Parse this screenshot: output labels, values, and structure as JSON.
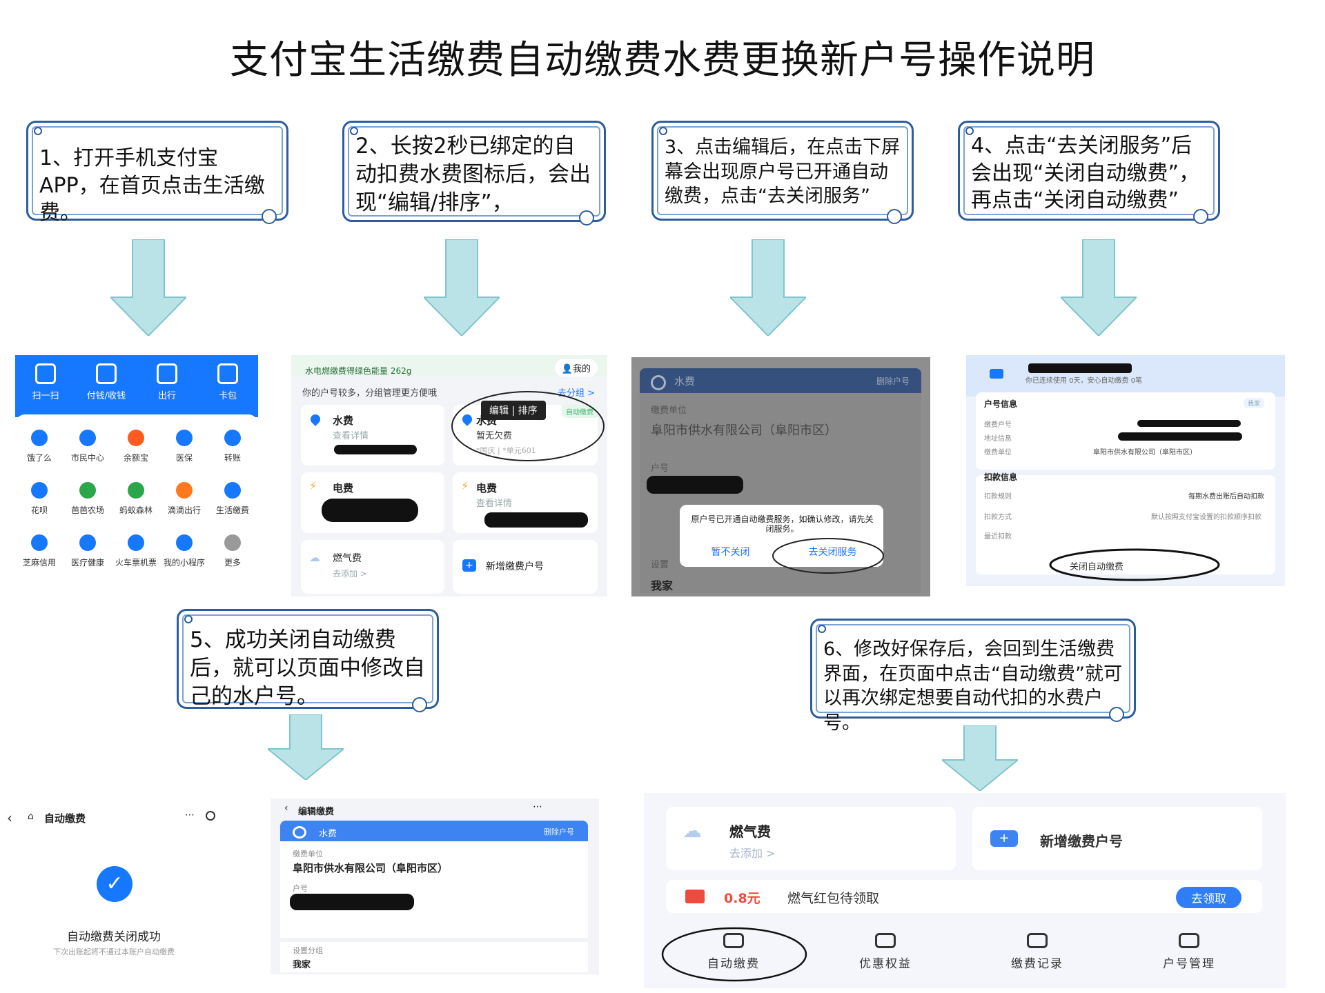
{
  "title": "支付宝生活缴费自动缴费水费更换新户号操作说明",
  "colors": {
    "arrow_fill": "#b9e3e6",
    "arrow_stroke": "#7fc5cb",
    "callout_border": "#2c5d9e",
    "alipay_blue": "#1677ff"
  },
  "steps": [
    "1、打开手机支付宝APP，在首页点击生活缴费。",
    "2、长按2秒已绑定的自动扣费水费图标后，会出现“编辑/排序”，",
    "3、点击编辑后，在点击下屏幕会出现原户号已开通自动缴费，点击“去关闭服务”",
    "4、点击“去关闭服务”后会出现“关闭自动缴费”，再点击“关闭自动缴费”",
    "5、成功关闭自动缴费后，就可以页面中修改自己的水户号。",
    "6、修改好保存后，会回到生活缴费界面，在页面中点击“自动缴费”就可以再次绑定想要自动代扣的水费户号。"
  ],
  "s1": {
    "top": [
      {
        "label": "扫一扫",
        "icon": "scan-icon"
      },
      {
        "label": "付钱/收钱",
        "icon": "pay-icon"
      },
      {
        "label": "出行",
        "icon": "travel-icon"
      },
      {
        "label": "卡包",
        "icon": "card-icon"
      }
    ],
    "grid": [
      {
        "label": "饿了么",
        "icon": "eleme-icon",
        "color": "#1677ff"
      },
      {
        "label": "市民中心",
        "icon": "citizen-icon",
        "color": "#1677ff"
      },
      {
        "label": "余额宝",
        "icon": "yuebao-icon",
        "color": "#ff5a1f"
      },
      {
        "label": "医保",
        "icon": "medical-insurance-icon",
        "color": "#1677ff"
      },
      {
        "label": "转账",
        "icon": "transfer-icon",
        "color": "#1677ff"
      },
      {
        "label": "花呗",
        "icon": "huabei-icon",
        "color": "#1677ff"
      },
      {
        "label": "芭芭农场",
        "icon": "farm-icon",
        "color": "#2ca64a"
      },
      {
        "label": "蚂蚁森林",
        "icon": "forest-icon",
        "color": "#2ca64a"
      },
      {
        "label": "滴滴出行",
        "icon": "didi-icon",
        "color": "#ff7a1f"
      },
      {
        "label": "生活缴费",
        "icon": "utility-bill-icon",
        "color": "#1677ff"
      },
      {
        "label": "芝麻信用",
        "icon": "zhima-icon",
        "color": "#1677ff"
      },
      {
        "label": "医疗健康",
        "icon": "health-icon",
        "color": "#1677ff"
      },
      {
        "label": "火车票机票",
        "icon": "ticket-icon",
        "color": "#1677ff"
      },
      {
        "label": "我的小程序",
        "icon": "miniapp-icon",
        "color": "#1677ff"
      },
      {
        "label": "更多",
        "icon": "more-icon",
        "color": "#999999"
      }
    ]
  },
  "s2": {
    "banner": "水电燃缴费得绿色能量 262g",
    "mine": "我的",
    "hint": "你的户号较多，分组管理更方便哦",
    "group_link": "去分组 >",
    "popup": "编辑 | 排序",
    "water": "水费",
    "water_detail": "查看详情",
    "water2_sub": "暂无欠费",
    "water2_tag": "*国庆 | *单元601",
    "auto_tag": "自动缴费",
    "elec": "电费",
    "elec_detail": "查看详情",
    "gas": "燃气费",
    "gas_add": "去添加 >",
    "add_account": "新增缴费户号"
  },
  "s3": {
    "header": "水费",
    "delete": "删除户号",
    "unit_label": "缴费单位",
    "unit": "阜阳市供水有限公司（阜阳市区）",
    "account_label": "户号",
    "group_label": "设置",
    "group": "我家",
    "dialog_text": "原户号已开通自动缴费服务，如确认修改，请先关闭服务。",
    "cancel": "暂不关闭",
    "confirm": "去关闭服务"
  },
  "s4": {
    "days": "你已连续使用 0天，安心自动缴费 0笔",
    "account_info": "户号信息",
    "tag": "我家",
    "rows": [
      "缴费户号",
      "地址信息",
      "缴费单位"
    ],
    "unit": "阜阳市供水有限公司（阜阳市区）",
    "deduct_info": "扣款信息",
    "rule_label": "扣款规则",
    "rule": "每期水费出账后自动扣款",
    "method_label": "扣款方式",
    "method": "默认按照支付宝设置的扣款顺序扣款",
    "recent_label": "最近扣款",
    "close_btn": "关闭自动缴费"
  },
  "s5a": {
    "title": "自动缴费",
    "success": "自动缴费关闭成功",
    "note": "下次出账起将不通过本账户自动缴费"
  },
  "s5b": {
    "title": "编辑缴费",
    "header": "水费",
    "delete": "删除户号",
    "unit_label": "缴费单位",
    "unit": "阜阳市供水有限公司（阜阳市区）",
    "account_label": "户号",
    "group_label": "设置分组",
    "group": "我家"
  },
  "s6": {
    "gas": "燃气费",
    "gas_add": "去添加 >",
    "add_account": "新增缴费户号",
    "promo_amount": "0.8元",
    "promo_text": "燃气红包待领取",
    "promo_btn": "去领取",
    "tabs": [
      {
        "label": "自动缴费",
        "icon": "shield-check-icon"
      },
      {
        "label": "优惠权益",
        "icon": "gift-icon"
      },
      {
        "label": "缴费记录",
        "icon": "record-icon"
      },
      {
        "label": "户号管理",
        "icon": "gear-icon"
      }
    ]
  }
}
